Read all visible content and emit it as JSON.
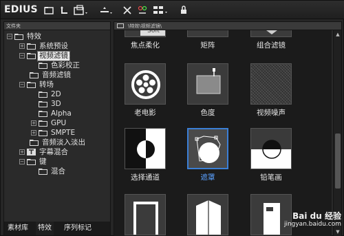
{
  "app": {
    "title": "EDIUS"
  },
  "left_panel": {
    "header": "文件夹",
    "tree": [
      {
        "label": "特效",
        "expander": "−",
        "level": 0
      },
      {
        "label": "系统预设",
        "expander": "+",
        "level": 1
      },
      {
        "label": "视频滤镜",
        "expander": "−",
        "level": 1,
        "selected": true
      },
      {
        "label": "色彩校正",
        "expander": "",
        "level": 2
      },
      {
        "label": "音频滤镜",
        "expander": "",
        "level": 1
      },
      {
        "label": "转场",
        "expander": "−",
        "level": 1
      },
      {
        "label": "2D",
        "expander": "",
        "level": 2
      },
      {
        "label": "3D",
        "expander": "",
        "level": 2
      },
      {
        "label": "Alpha",
        "expander": "",
        "level": 2
      },
      {
        "label": "GPU",
        "expander": "+",
        "level": 2
      },
      {
        "label": "SMPTE",
        "expander": "+",
        "level": 2
      },
      {
        "label": "音频淡入淡出",
        "expander": "",
        "level": 1
      },
      {
        "label": "字幕混合",
        "expander": "+",
        "level": 1
      },
      {
        "label": "键",
        "expander": "−",
        "level": 1
      },
      {
        "label": "混合",
        "expander": "",
        "level": 2
      }
    ],
    "tabs": [
      "素材库",
      "特效",
      "序列标记"
    ]
  },
  "right_panel": {
    "path": "\\特效\\视频滤镜\\",
    "top_row_labels": [
      "焦点柔化",
      "矩阵",
      "组合滤镜"
    ],
    "soft_text": "Soft",
    "effects": [
      {
        "label": "老电影",
        "icon": "film-reel-icon"
      },
      {
        "label": "色度",
        "icon": "chroma-icon"
      },
      {
        "label": "视频噪声",
        "icon": "noise-icon"
      },
      {
        "label": "选择通道",
        "icon": "channel-icon"
      },
      {
        "label": "遮罩",
        "icon": "mask-icon",
        "selected": true
      },
      {
        "label": "铅笔画",
        "icon": "pencil-icon"
      }
    ]
  },
  "watermark": {
    "logo": "Bai du 经验",
    "url": "jingyan.baidu.com"
  },
  "colors": {
    "selection_blue": "#3b7fd6",
    "panel_bg": "#2a2a2a"
  }
}
